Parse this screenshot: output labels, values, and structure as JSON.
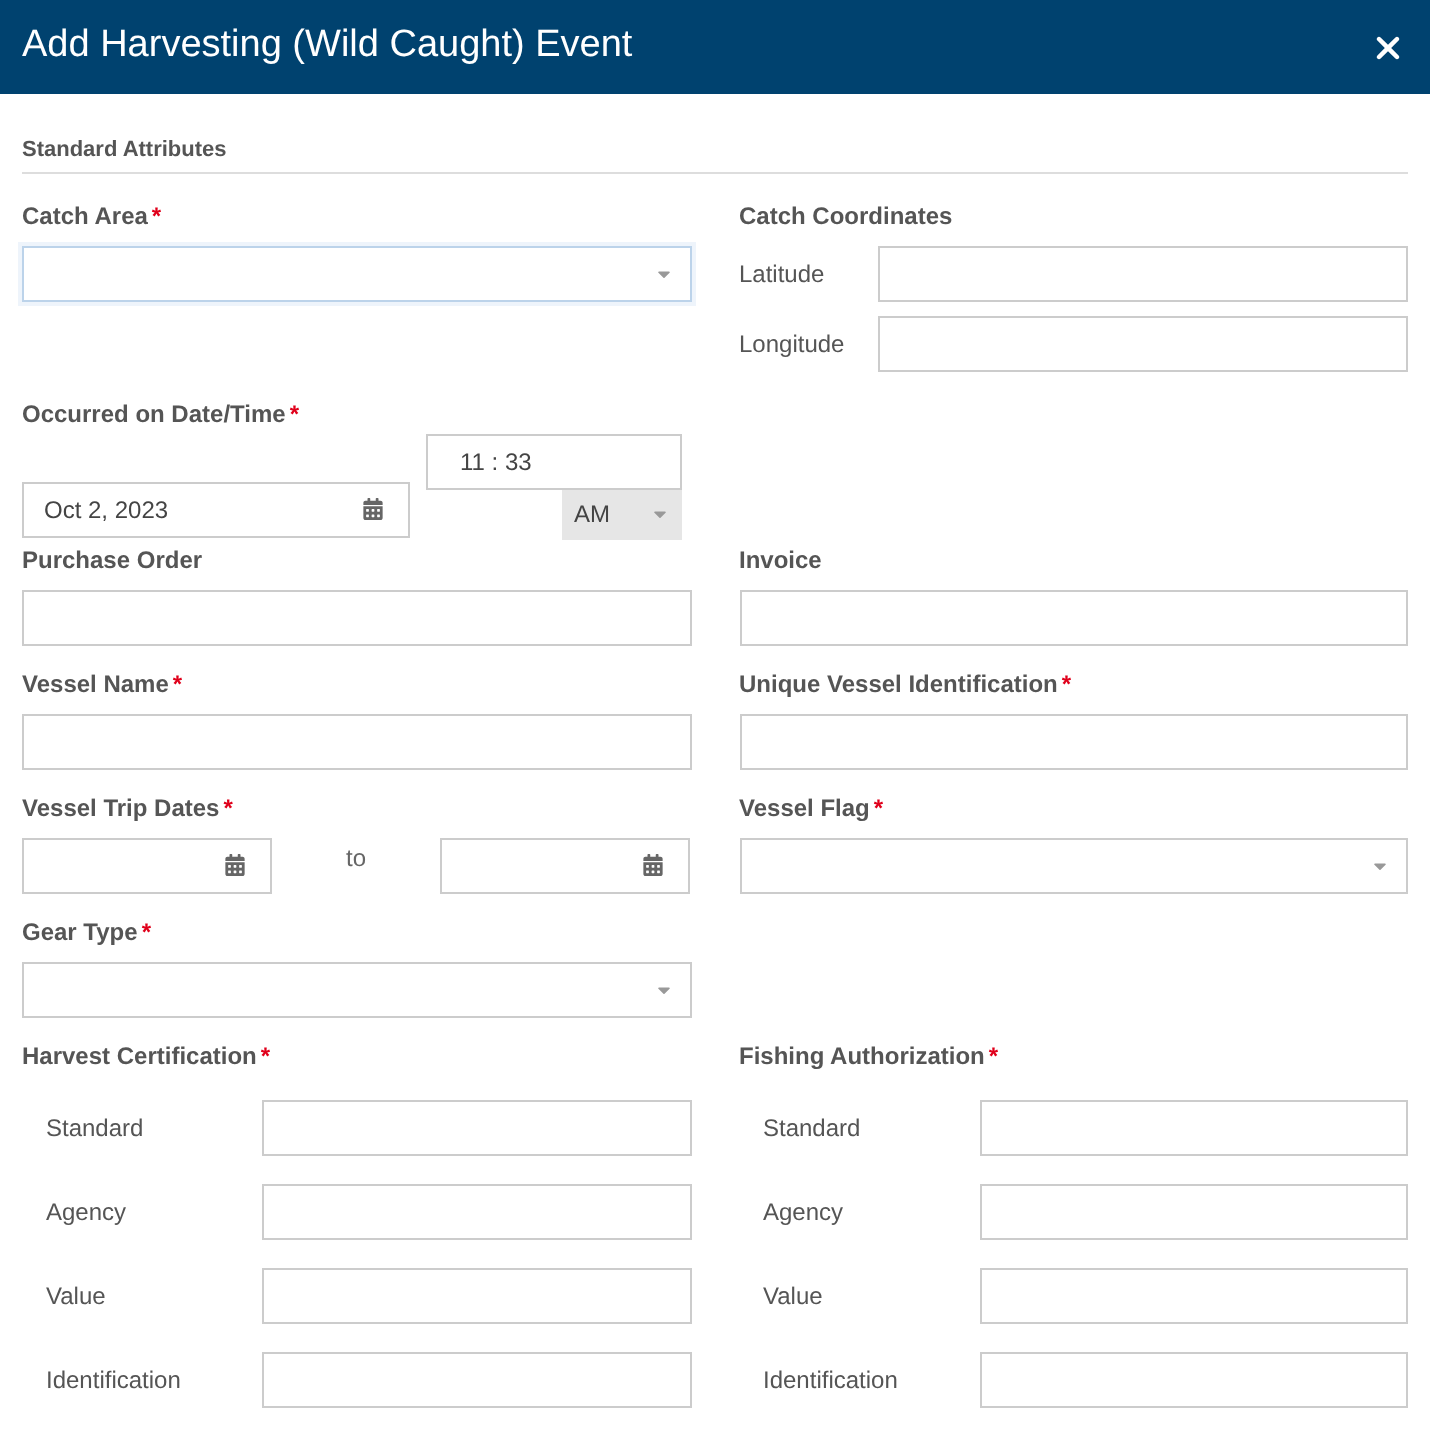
{
  "dialog": {
    "title": "Add Harvesting (Wild Caught) Event"
  },
  "section": "Standard Attributes",
  "top": {
    "catch_area": {
      "label": "Catch Area",
      "required_mark": "*",
      "focused": true
    },
    "catch_coordinates": {
      "label": "Catch Coordinates",
      "fields": [
        {
          "label": "Latitude"
        },
        {
          "label": "Longitude"
        }
      ]
    }
  },
  "occurred": {
    "label": "Occurred on Date/Time",
    "required_mark": "*",
    "date": "Oct 2, 2023",
    "time": "11 : 33",
    "meridiem": "AM"
  },
  "rows": [
    [
      {
        "kind": "text",
        "label": "Purchase Order"
      },
      {
        "kind": "text",
        "label": "Invoice"
      }
    ],
    [
      {
        "kind": "text",
        "label": "Vessel Name",
        "required_mark": "*"
      },
      {
        "kind": "text",
        "label": "Unique Vessel Identification",
        "required_mark": "*"
      }
    ],
    [
      {
        "kind": "date_range",
        "label": "Vessel Trip Dates",
        "required_mark": "*",
        "separator": "to"
      },
      {
        "kind": "select",
        "label": "Vessel Flag",
        "required_mark": "*"
      }
    ],
    [
      {
        "kind": "select",
        "label": "Gear Type",
        "required_mark": "*"
      }
    ]
  ],
  "groups": [
    {
      "label": "Harvest Certification",
      "required_mark": "*",
      "fields": [
        {
          "label": "Standard"
        },
        {
          "label": "Agency"
        },
        {
          "label": "Value"
        },
        {
          "label": "Identification"
        }
      ]
    },
    {
      "label": "Fishing Authorization",
      "required_mark": "*",
      "fields": [
        {
          "label": "Standard"
        },
        {
          "label": "Agency"
        },
        {
          "label": "Value"
        },
        {
          "label": "Identification"
        }
      ]
    }
  ]
}
